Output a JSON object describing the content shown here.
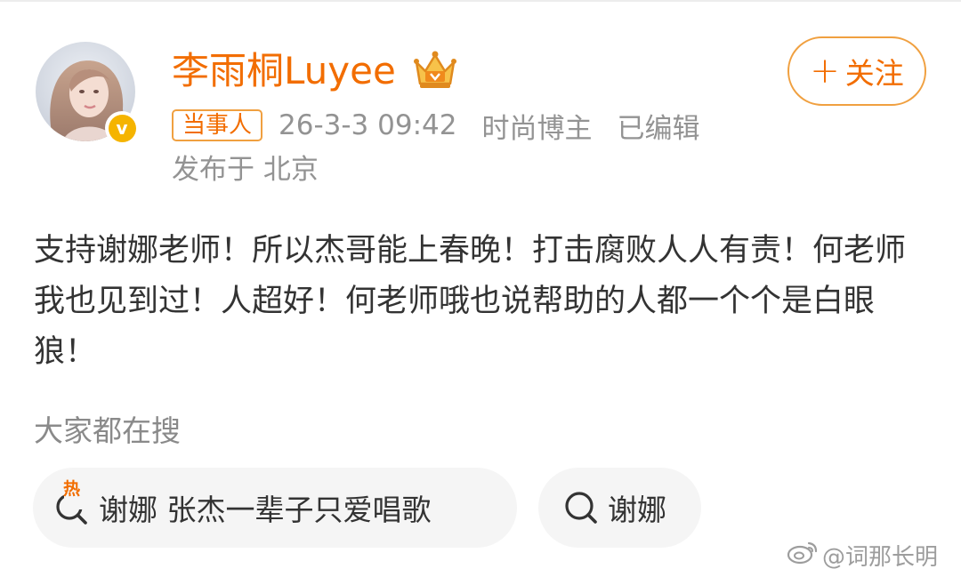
{
  "user": {
    "name": "李雨桐Luyee",
    "verified_badge": "v",
    "avatar_icon": "avatar-photo",
    "crown_icon": "vip-crown-icon"
  },
  "follow_button": {
    "plus": "+",
    "label": "关注"
  },
  "post_meta": {
    "tag": "当事人",
    "timestamp": "26-3-3 09:42",
    "category": "时尚博主",
    "edited": "已编辑",
    "location": "发布于 北京"
  },
  "post": {
    "text": "支持谢娜老师！所以杰哥能上春晚！打击腐败人人有责！何老师我也见到过！人超好！何老师哦也说帮助的人都一个个是白眼狼！"
  },
  "trending": {
    "title": "大家都在搜",
    "items": [
      {
        "hot_label": "热",
        "text": "谢娜 张杰一辈子只爱唱歌",
        "icon": "hot-search-icon"
      },
      {
        "text": "谢娜",
        "icon": "search-icon"
      }
    ]
  },
  "watermark": {
    "text": "@词那长明",
    "icon": "weibo-logo-icon"
  },
  "colors": {
    "accent": "#f26d00",
    "border_accent": "#f0a040",
    "meta_text": "#939393",
    "body_text": "#333333",
    "chip_bg": "#f5f5f5"
  }
}
